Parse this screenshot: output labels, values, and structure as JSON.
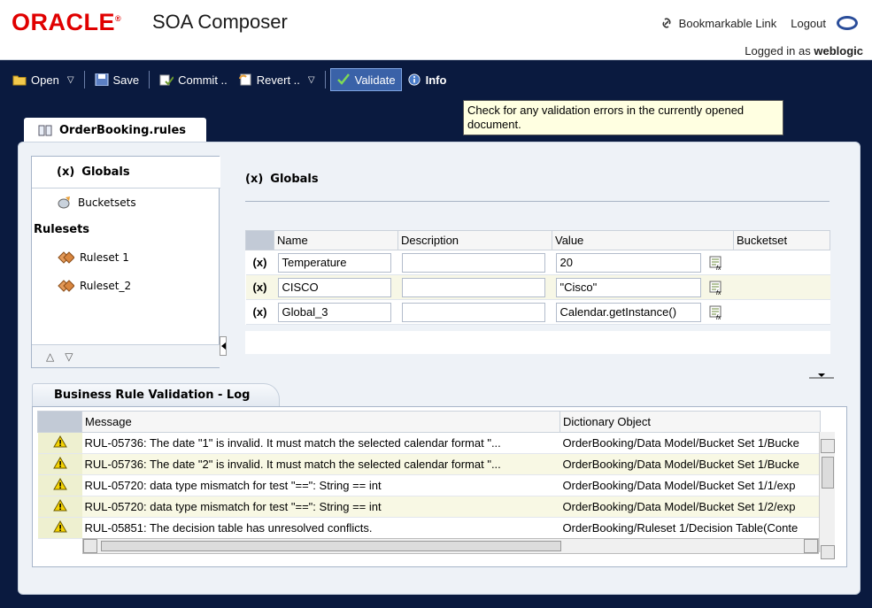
{
  "header": {
    "logo": "ORACLE",
    "app_title": "SOA Composer",
    "bookmark_link": "Bookmarkable Link",
    "logout": "Logout",
    "logged_in_prefix": "Logged in as",
    "username": "weblogic"
  },
  "toolbar": {
    "open": "Open",
    "save": "Save",
    "commit": "Commit ..",
    "revert": "Revert ..",
    "validate": "Validate",
    "info": "Info"
  },
  "tooltip": "Check for any validation errors in the currently opened document.",
  "doc_tab": "OrderBooking.rules",
  "nav": {
    "globals": "Globals",
    "globals_symbol": "(x)",
    "bucketsets": "Bucketsets",
    "rulesets_header": "Rulesets",
    "ruleset1": "Ruleset 1",
    "ruleset2": "Ruleset_2"
  },
  "globals_panel": {
    "title": "Globals",
    "symbol": "(x)",
    "columns": [
      "Name",
      "Description",
      "Value",
      "Bucketset"
    ],
    "rows": [
      {
        "name": "Temperature",
        "description": "",
        "value": "20"
      },
      {
        "name": "CISCO",
        "description": "",
        "value": "\"Cisco\""
      },
      {
        "name": "Global_3",
        "description": "",
        "value": "Calendar.getInstance()"
      }
    ]
  },
  "log": {
    "tab": "Business Rule Validation - Log",
    "columns": [
      "Message",
      "Dictionary Object"
    ],
    "rows": [
      {
        "message": "RUL-05736: The date \"1\" is invalid. It must match the selected calendar format \"...",
        "object": "OrderBooking/Data Model/Bucket Set 1/Bucke"
      },
      {
        "message": "RUL-05736: The date \"2\" is invalid. It must match the selected calendar format \"...",
        "object": "OrderBooking/Data Model/Bucket Set 1/Bucke"
      },
      {
        "message": "RUL-05720: data type mismatch for test \"==\": String == int",
        "object": "OrderBooking/Data Model/Bucket Set 1/1/exp"
      },
      {
        "message": "RUL-05720: data type mismatch for test \"==\": String == int",
        "object": "OrderBooking/Data Model/Bucket Set 1/2/exp"
      },
      {
        "message": "RUL-05851: The decision table has unresolved conflicts.",
        "object": "OrderBooking/Ruleset 1/Decision Table(Conte"
      }
    ]
  },
  "colors": {
    "oracle_red": "#e00000",
    "dark_bg": "#0a1a3f",
    "panel_bg": "#eef2f7",
    "warning_yellow": "#f5d300"
  }
}
